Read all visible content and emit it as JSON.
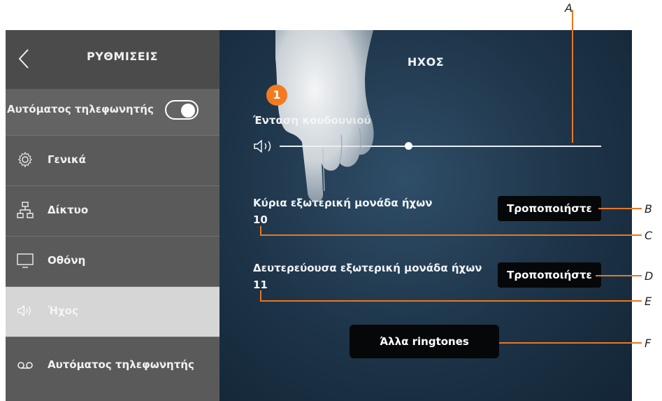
{
  "sidebar": {
    "title": "ΡΥΘΜΙΣΕΙΣ",
    "auto_answer_label": "Αυτόματος τηλεφωνητής",
    "auto_answer_on": true,
    "items": [
      {
        "label": "Γενικά",
        "icon": "gear-icon"
      },
      {
        "label": "Δίκτυο",
        "icon": "network-icon"
      },
      {
        "label": "Οθόνη",
        "icon": "monitor-icon"
      },
      {
        "label": "Ήχος",
        "icon": "speaker-icon",
        "active": true
      },
      {
        "label": "Αυτόματος τηλεφωνητής",
        "icon": "voicemail-icon"
      }
    ]
  },
  "main": {
    "title": "ΗΧΟΣ",
    "ringer_volume_label": "Ένταση κουδουνιού",
    "ringer_volume_level": 0.4,
    "main_unit_label": "Κύρια εξωτερική μονάδα ήχων",
    "main_unit_value": "10",
    "main_unit_button": "Τροποποιήστε",
    "secondary_unit_label": "Δευτερεύουσα εξωτερική μονάδα ήχων",
    "secondary_unit_value": "11",
    "secondary_unit_button": "Τροποποιήστε",
    "other_ringtones_button": "Άλλα ringtones"
  },
  "annotations": {
    "step_badge": "1",
    "callouts": [
      "A",
      "B",
      "C",
      "D",
      "E",
      "F"
    ]
  },
  "colors": {
    "accent": "#e87722",
    "badge": "#f47a20",
    "sidebar": "#5a5a5a",
    "sidebar_active": "#d6d6d6",
    "main_bg": "#1d3347"
  }
}
